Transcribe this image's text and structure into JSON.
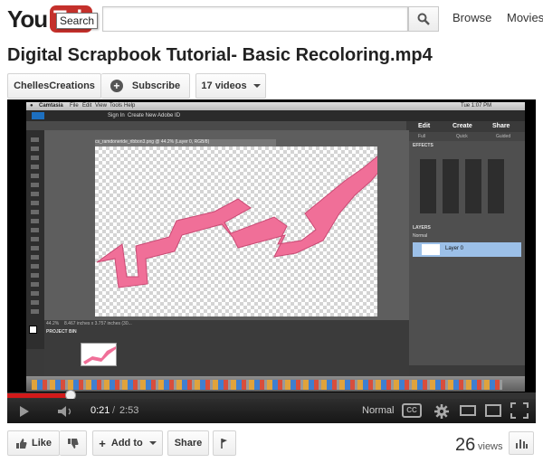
{
  "header": {
    "logo_you": "You",
    "logo_tube": "Tube",
    "tooltip": "Search",
    "search_value": "",
    "nav": [
      "Browse",
      "Movies"
    ]
  },
  "video": {
    "title": "Digital Scrapbook Tutorial- Basic Recoloring.mp4",
    "channel": "ChellesCreations",
    "subscribe_label": "Subscribe",
    "videos_label": "17 videos"
  },
  "player": {
    "app_name": "Camtasia",
    "menu": [
      "File",
      "Edit",
      "View",
      "Tools",
      "Help"
    ],
    "clock": "Tue 1:07 PM",
    "sign_in": "Sign In",
    "create_id": "Create New Adobe ID",
    "panel_tabs": [
      "Edit",
      "Create",
      "Share"
    ],
    "panel_subtabs": [
      "Full",
      "Quick",
      "Guided"
    ],
    "effects_label": "EFFECTS",
    "layers_label": "LAYERS",
    "layer_name": "Layer 0",
    "blend_mode": "Normal",
    "doc_tab": "cs_ramdoneride_ribbon3.png @ 44.2% (Layer 0, RGB/8)",
    "status_zoom": "44.2%",
    "status_size": "8.467 inches x 3.757 inches (30...",
    "project_bin": "PROJECT BIN",
    "time_current": "0:21",
    "time_total": "2:53",
    "quality": "Normal",
    "progress": 0.12
  },
  "actions": {
    "like": "Like",
    "add_to": "Add to",
    "share": "Share",
    "views_count": "26",
    "views_label": "views"
  },
  "colors": {
    "brand_red": "#c4302b",
    "progress_red": "#d21a1a",
    "ribbon": "#f06f98"
  }
}
